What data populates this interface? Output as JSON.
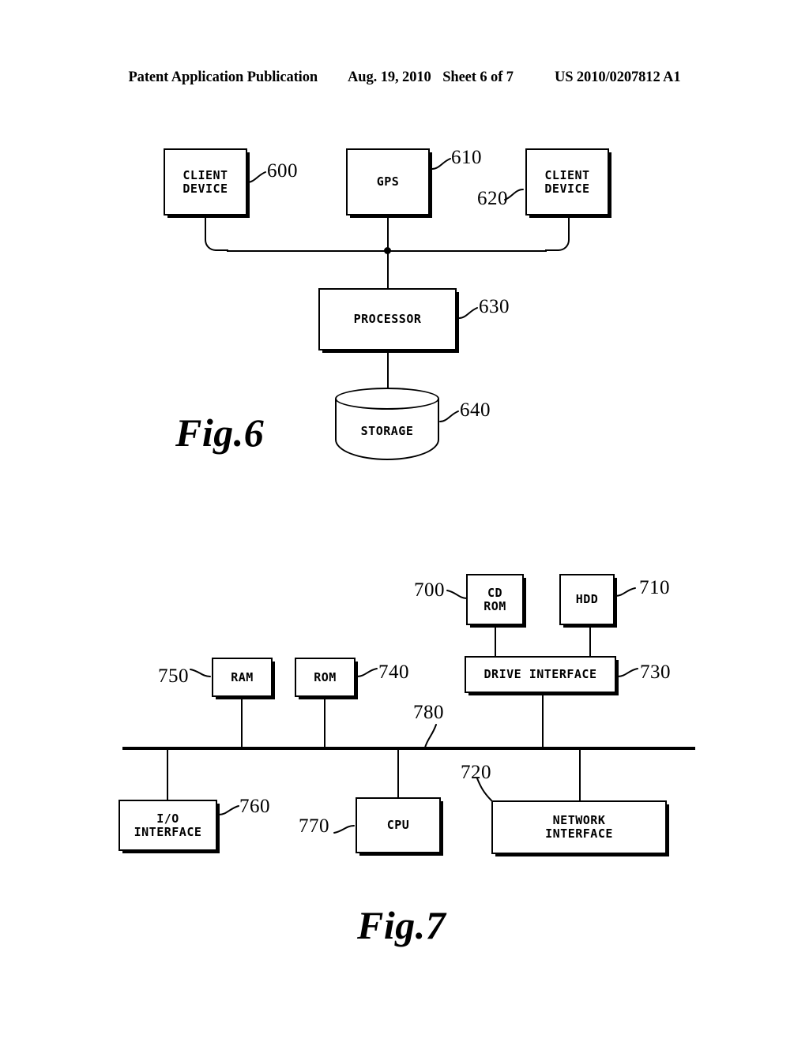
{
  "header": {
    "publication": "Patent Application Publication",
    "date": "Aug. 19, 2010",
    "sheet": "Sheet 6 of 7",
    "patent_number": "US 2010/0207812 A1"
  },
  "figures": [
    {
      "caption": "Fig.6",
      "nodes": [
        {
          "id": "client-device-600",
          "label_lines": [
            "CLIENT",
            "DEVICE"
          ],
          "ref": "600",
          "shape": "box"
        },
        {
          "id": "gps-610",
          "label_lines": [
            "GPS"
          ],
          "ref": "610",
          "shape": "box"
        },
        {
          "id": "client-device-620",
          "label_lines": [
            "CLIENT",
            "DEVICE"
          ],
          "ref": "620",
          "shape": "box"
        },
        {
          "id": "processor-630",
          "label_lines": [
            "PROCESSOR"
          ],
          "ref": "630",
          "shape": "box"
        },
        {
          "id": "storage-640",
          "label_lines": [
            "STORAGE"
          ],
          "ref": "640",
          "shape": "cylinder"
        }
      ]
    },
    {
      "caption": "Fig.7",
      "nodes": [
        {
          "id": "cd-rom-700",
          "label_lines": [
            "CD",
            "ROM"
          ],
          "ref": "700",
          "shape": "box"
        },
        {
          "id": "hdd-710",
          "label_lines": [
            "HDD"
          ],
          "ref": "710",
          "shape": "box"
        },
        {
          "id": "network-interface-720",
          "label_lines": [
            "NETWORK",
            "INTERFACE"
          ],
          "ref": "720",
          "shape": "box"
        },
        {
          "id": "drive-interface-730",
          "label_lines": [
            "DRIVE INTERFACE"
          ],
          "ref": "730",
          "shape": "box"
        },
        {
          "id": "rom-740",
          "label_lines": [
            "ROM"
          ],
          "ref": "740",
          "shape": "box"
        },
        {
          "id": "ram-750",
          "label_lines": [
            "RAM"
          ],
          "ref": "750",
          "shape": "box"
        },
        {
          "id": "io-interface-760",
          "label_lines": [
            "I/O",
            "INTERFACE"
          ],
          "ref": "760",
          "shape": "box"
        },
        {
          "id": "cpu-770",
          "label_lines": [
            "CPU"
          ],
          "ref": "770",
          "shape": "box"
        },
        {
          "id": "bus-780",
          "label_lines": [],
          "ref": "780",
          "shape": "bus"
        }
      ]
    }
  ],
  "fig6": {
    "client_device_600": "CLIENT\nDEVICE",
    "client_device_600_l1": "CLIENT",
    "client_device_600_l2": "DEVICE",
    "ref_600": "600",
    "gps": "GPS",
    "ref_610": "610",
    "client_device_620_l1": "CLIENT",
    "client_device_620_l2": "DEVICE",
    "ref_620": "620",
    "processor": "PROCESSOR",
    "ref_630": "630",
    "storage": "STORAGE",
    "ref_640": "640",
    "caption": "Fig.6"
  },
  "fig7": {
    "cd_rom_l1": "CD",
    "cd_rom_l2": "ROM",
    "ref_700": "700",
    "hdd": "HDD",
    "ref_710": "710",
    "ram": "RAM",
    "ref_750": "750",
    "rom": "ROM",
    "ref_740": "740",
    "drive_interface": "DRIVE INTERFACE",
    "ref_730": "730",
    "ref_780": "780",
    "io_interface_l1": "I/O",
    "io_interface_l2": "INTERFACE",
    "ref_760": "760",
    "cpu": "CPU",
    "ref_770": "770",
    "network_interface_l1": "NETWORK",
    "network_interface_l2": "INTERFACE",
    "ref_720": "720",
    "caption": "Fig.7"
  },
  "colors": {
    "ink": "#000000",
    "paper": "#ffffff"
  }
}
